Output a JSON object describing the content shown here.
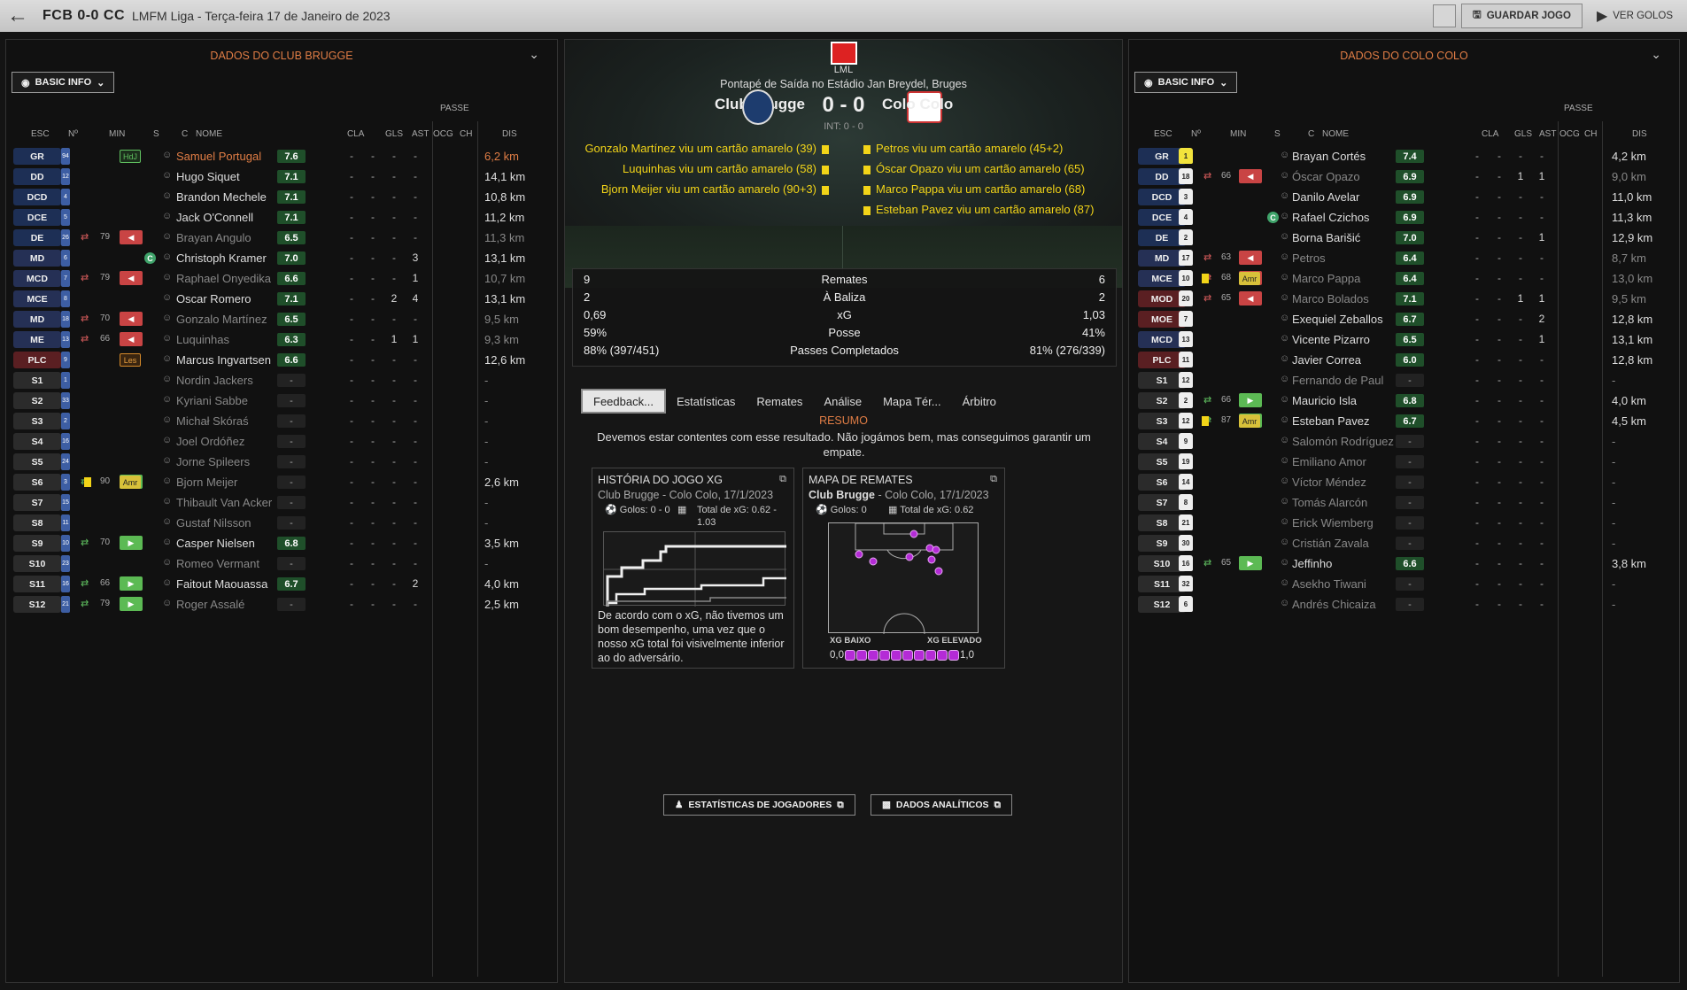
{
  "header": {
    "back_icon": "arrow-left-icon",
    "score_title": "FCB 0-0 CC",
    "subtitle": "LMFM Liga - Terça-feira 17 de Janeiro de 2023",
    "save_label": "GUARDAR JOGO",
    "goals_label": "VER GOLOS"
  },
  "left": {
    "title": "DADOS DO CLUB BRUGGE",
    "basic_info": "BASIC INFO",
    "passe": "PASSE",
    "columns": [
      "ESC",
      "Nº",
      "MIN",
      "S",
      "C",
      "NOME",
      "CLA",
      "GLS",
      "AST",
      "OCG",
      "CH",
      "DIS"
    ],
    "players": [
      {
        "pos": "GR",
        "num": "94",
        "s": "HdJ",
        "name": "Samuel Portugal",
        "cla": "7.6",
        "gls": "-",
        "ast": "-",
        "ocg": "-",
        "ch": "-",
        "dis": "6,2 km"
      },
      {
        "pos": "DD",
        "num": "12",
        "name": "Hugo Siquet",
        "cla": "7.1",
        "gls": "-",
        "ast": "-",
        "ocg": "-",
        "ch": "-",
        "dis": "14,1 km"
      },
      {
        "pos": "DCD",
        "num": "4",
        "name": "Brandon Mechele",
        "cla": "7.1",
        "gls": "-",
        "ast": "-",
        "ocg": "-",
        "ch": "-",
        "dis": "10,8 km"
      },
      {
        "pos": "DCE",
        "num": "5",
        "name": "Jack O'Connell",
        "cla": "7.1",
        "gls": "-",
        "ast": "-",
        "ocg": "-",
        "ch": "-",
        "dis": "11,2 km"
      },
      {
        "pos": "DE",
        "num": "26",
        "min": "79",
        "name": "Brayan Angulo",
        "cla": "6.5",
        "gls": "-",
        "ast": "-",
        "ocg": "-",
        "ch": "-",
        "dis": "11,3 km"
      },
      {
        "pos": "MD",
        "num": "6",
        "c": "C",
        "name": "Christoph Kramer",
        "cla": "7.0",
        "gls": "-",
        "ast": "-",
        "ocg": "-",
        "ch": "3",
        "dis": "13,1 km"
      },
      {
        "pos": "MCD",
        "num": "7",
        "min": "79",
        "name": "Raphael Onyedika",
        "cla": "6.6",
        "gls": "-",
        "ast": "-",
        "ocg": "-",
        "ch": "1",
        "dis": "10,7 km"
      },
      {
        "pos": "MCE",
        "num": "8",
        "name": "Oscar Romero",
        "cla": "7.1",
        "gls": "-",
        "ast": "-",
        "ocg": "2",
        "ch": "4",
        "dis": "13,1 km"
      },
      {
        "pos": "MD",
        "num": "18",
        "min": "70",
        "name": "Gonzalo Martínez",
        "cla": "6.5",
        "gls": "-",
        "ast": "-",
        "ocg": "-",
        "ch": "-",
        "dis": "9,5 km"
      },
      {
        "pos": "ME",
        "num": "13",
        "min": "66",
        "name": "Luquinhas",
        "cla": "6.3",
        "gls": "-",
        "ast": "-",
        "ocg": "1",
        "ch": "1",
        "dis": "9,3 km"
      },
      {
        "pos": "PLC",
        "num": "9",
        "s": "Les",
        "name": "Marcus Ingvartsen",
        "cla": "6.6",
        "gls": "-",
        "ast": "-",
        "ocg": "-",
        "ch": "-",
        "dis": "12,6 km"
      },
      {
        "pos": "S1",
        "num": "1",
        "name": "Nordin Jackers",
        "cla": "-",
        "gls": "-",
        "ast": "-",
        "ocg": "-",
        "ch": "-",
        "dis": "-"
      },
      {
        "pos": "S2",
        "num": "33",
        "name": "Kyriani Sabbe",
        "cla": "-",
        "gls": "-",
        "ast": "-",
        "ocg": "-",
        "ch": "-",
        "dis": "-"
      },
      {
        "pos": "S3",
        "num": "2",
        "name": "Michał Skóraś",
        "cla": "-",
        "gls": "-",
        "ast": "-",
        "ocg": "-",
        "ch": "-",
        "dis": "-"
      },
      {
        "pos": "S4",
        "num": "16",
        "name": "Joel Ordóñez",
        "cla": "-",
        "gls": "-",
        "ast": "-",
        "ocg": "-",
        "ch": "-",
        "dis": "-"
      },
      {
        "pos": "S5",
        "num": "24",
        "name": "Jorne Spileers",
        "cla": "-",
        "gls": "-",
        "ast": "-",
        "ocg": "-",
        "ch": "-",
        "dis": "-"
      },
      {
        "pos": "S6",
        "num": "3",
        "min": "90",
        "s": "Amr",
        "name": "Bjorn Meijer",
        "cla": "-",
        "gls": "-",
        "ast": "-",
        "ocg": "-",
        "ch": "-",
        "dis": "2,6 km"
      },
      {
        "pos": "S7",
        "num": "15",
        "name": "Thibault Van Acker",
        "cla": "-",
        "gls": "-",
        "ast": "-",
        "ocg": "-",
        "ch": "-",
        "dis": "-"
      },
      {
        "pos": "S8",
        "num": "11",
        "name": "Gustaf Nilsson",
        "cla": "-",
        "gls": "-",
        "ast": "-",
        "ocg": "-",
        "ch": "-",
        "dis": "-"
      },
      {
        "pos": "S9",
        "num": "10",
        "min": "70",
        "name": "Casper Nielsen",
        "cla": "6.8",
        "gls": "-",
        "ast": "-",
        "ocg": "-",
        "ch": "-",
        "dis": "3,5 km"
      },
      {
        "pos": "S10",
        "num": "23",
        "name": "Romeo Vermant",
        "cla": "-",
        "gls": "-",
        "ast": "-",
        "ocg": "-",
        "ch": "-",
        "dis": "-"
      },
      {
        "pos": "S11",
        "num": "16",
        "min": "66",
        "name": "Faitout Maouassa",
        "cla": "6.7",
        "gls": "-",
        "ast": "-",
        "ocg": "-",
        "ch": "2",
        "dis": "4,0 km"
      },
      {
        "pos": "S12",
        "num": "21",
        "min": "79",
        "name": "Roger Assalé",
        "cla": "-",
        "gls": "-",
        "ast": "-",
        "ocg": "-",
        "ch": "-",
        "dis": "2,5 km"
      }
    ]
  },
  "right": {
    "title": "DADOS DO COLO COLO",
    "basic_info": "BASIC INFO",
    "passe": "PASSE",
    "players": [
      {
        "pos": "GR",
        "num": "1",
        "name": "Brayan Cortés",
        "cla": "7.4",
        "gls": "-",
        "ast": "-",
        "ocg": "-",
        "ch": "-",
        "dis": "4,2 km"
      },
      {
        "pos": "DD",
        "num": "18",
        "min": "66",
        "name": "Óscar Opazo",
        "cla": "6.9",
        "gls": "-",
        "ast": "-",
        "ocg": "1",
        "ch": "1",
        "dis": "9,0 km"
      },
      {
        "pos": "DCD",
        "num": "3",
        "name": "Danilo Avelar",
        "cla": "6.9",
        "gls": "-",
        "ast": "-",
        "ocg": "-",
        "ch": "-",
        "dis": "11,0 km"
      },
      {
        "pos": "DCE",
        "num": "4",
        "c": "C",
        "name": "Rafael Czichos",
        "cla": "6.9",
        "gls": "-",
        "ast": "-",
        "ocg": "-",
        "ch": "-",
        "dis": "11,3 km"
      },
      {
        "pos": "DE",
        "num": "2",
        "name": "Borna Barišić",
        "cla": "7.0",
        "gls": "-",
        "ast": "-",
        "ocg": "-",
        "ch": "1",
        "dis": "12,9 km"
      },
      {
        "pos": "MD",
        "num": "17",
        "min": "63",
        "name": "Petros",
        "cla": "6.4",
        "gls": "-",
        "ast": "-",
        "ocg": "-",
        "ch": "-",
        "dis": "8,7 km"
      },
      {
        "pos": "MCE",
        "num": "10",
        "min": "68",
        "s": "Amr",
        "name": "Marco Pappa",
        "cla": "6.4",
        "gls": "-",
        "ast": "-",
        "ocg": "-",
        "ch": "-",
        "dis": "13,0 km"
      },
      {
        "pos": "MOD",
        "num": "20",
        "min": "65",
        "name": "Marco Bolados",
        "cla": "7.1",
        "gls": "-",
        "ast": "-",
        "ocg": "1",
        "ch": "1",
        "dis": "9,5 km"
      },
      {
        "pos": "MOE",
        "num": "7",
        "name": "Exequiel Zeballos",
        "cla": "6.7",
        "gls": "-",
        "ast": "-",
        "ocg": "-",
        "ch": "2",
        "dis": "12,8 km"
      },
      {
        "pos": "MCD",
        "num": "13",
        "name": "Vicente Pizarro",
        "cla": "6.5",
        "gls": "-",
        "ast": "-",
        "ocg": "-",
        "ch": "1",
        "dis": "13,1 km"
      },
      {
        "pos": "PLC",
        "num": "11",
        "name": "Javier Correa",
        "cla": "6.0",
        "gls": "-",
        "ast": "-",
        "ocg": "-",
        "ch": "-",
        "dis": "12,8 km"
      },
      {
        "pos": "S1",
        "num": "12",
        "name": "Fernando de Paul",
        "cla": "-",
        "gls": "-",
        "ast": "-",
        "ocg": "-",
        "ch": "-",
        "dis": "-"
      },
      {
        "pos": "S2",
        "num": "2",
        "min": "66",
        "name": "Mauricio Isla",
        "cla": "6.8",
        "gls": "-",
        "ast": "-",
        "ocg": "-",
        "ch": "-",
        "dis": "4,0 km"
      },
      {
        "pos": "S3",
        "num": "12",
        "min": "87",
        "s": "Amr",
        "name": "Esteban Pavez",
        "cla": "6.7",
        "gls": "-",
        "ast": "-",
        "ocg": "-",
        "ch": "-",
        "dis": "4,5 km"
      },
      {
        "pos": "S4",
        "num": "9",
        "name": "Salomón Rodríguez",
        "cla": "-",
        "gls": "-",
        "ast": "-",
        "ocg": "-",
        "ch": "-",
        "dis": "-"
      },
      {
        "pos": "S5",
        "num": "19",
        "name": "Emiliano Amor",
        "cla": "-",
        "gls": "-",
        "ast": "-",
        "ocg": "-",
        "ch": "-",
        "dis": "-"
      },
      {
        "pos": "S6",
        "num": "14",
        "name": "Víctor Méndez",
        "cla": "-",
        "gls": "-",
        "ast": "-",
        "ocg": "-",
        "ch": "-",
        "dis": "-"
      },
      {
        "pos": "S7",
        "num": "8",
        "name": "Tomás Alarcón",
        "cla": "-",
        "gls": "-",
        "ast": "-",
        "ocg": "-",
        "ch": "-",
        "dis": "-"
      },
      {
        "pos": "S8",
        "num": "21",
        "name": "Erick Wiemberg",
        "cla": "-",
        "gls": "-",
        "ast": "-",
        "ocg": "-",
        "ch": "-",
        "dis": "-"
      },
      {
        "pos": "S9",
        "num": "30",
        "name": "Cristián Zavala",
        "cla": "-",
        "gls": "-",
        "ast": "-",
        "ocg": "-",
        "ch": "-",
        "dis": "-"
      },
      {
        "pos": "S10",
        "num": "16",
        "min": "65",
        "name": "Jeffinho",
        "cla": "6.6",
        "gls": "-",
        "ast": "-",
        "ocg": "-",
        "ch": "-",
        "dis": "3,8 km"
      },
      {
        "pos": "S11",
        "num": "32",
        "name": "Asekho Tiwani",
        "cla": "-",
        "gls": "-",
        "ast": "-",
        "ocg": "-",
        "ch": "-",
        "dis": "-"
      },
      {
        "pos": "S12",
        "num": "6",
        "name": "Andrés Chicaiza",
        "cla": "-",
        "gls": "-",
        "ast": "-",
        "ocg": "-",
        "ch": "-",
        "dis": "-"
      }
    ]
  },
  "center": {
    "league": "LML",
    "kickoff": "Pontapé de Saída no Estádio Jan Breydel, Bruges",
    "home": "Club Brugge",
    "away": "Colo Colo",
    "score": "0 - 0",
    "interval": "INT: 0 - 0",
    "home_events": [
      "Gonzalo Martínez viu um cartão amarelo (39)",
      "Luquinhas viu um cartão amarelo (58)",
      "Bjorn Meijer viu um cartão amarelo (90+3)"
    ],
    "away_events": [
      "Petros viu um cartão amarelo (45+2)",
      "Óscar Opazo viu um cartão amarelo (65)",
      "Marco Pappa viu um cartão amarelo (68)",
      "Esteban Pavez viu um cartão amarelo (87)"
    ],
    "stats": [
      {
        "home": "9",
        "label": "Remates",
        "away": "6"
      },
      {
        "home": "2",
        "label": "À Baliza",
        "away": "2"
      },
      {
        "home": "0,69",
        "label": "xG",
        "away": "1,03"
      },
      {
        "home": "59%",
        "label": "Posse",
        "away": "41%"
      },
      {
        "home": "88% (397/451)",
        "label": "Passes Completados",
        "away": "81% (276/339)"
      }
    ],
    "tabs": [
      "Feedback...",
      "Estatísticas",
      "Remates",
      "Análise",
      "Mapa Tér...",
      "Árbitro"
    ],
    "resumo": "RESUMO",
    "summary": "Devemos estar contentes com esse resultado. Não jogámos bem, mas conseguimos garantir um empate.",
    "card1": {
      "title": "HISTÓRIA DO JOGO XG",
      "sub": "Club Brugge - Colo Colo, 17/1/2023",
      "goals": "Golos: 0 - 0",
      "xg": "Total de xG: 0.62 - 1.03",
      "text": "De acordo com o xG, não tivemos um bom desempenho, uma vez que o nosso xG total foi visivelmente inferior ao do adversário."
    },
    "card2": {
      "title": "MAPA DE REMATES",
      "team": "Club Brugge",
      "sub": " - Colo Colo, 17/1/2023",
      "goals": "Golos: 0",
      "xg": "Total de xG: 0.62",
      "low": "XG BAIXO",
      "high": "XG ELEVADO",
      "min": "0,0",
      "max": "1,0"
    },
    "btn_players": "ESTATÍSTICAS DE JOGADORES",
    "btn_analytics": "DADOS ANALÍTICOS"
  }
}
